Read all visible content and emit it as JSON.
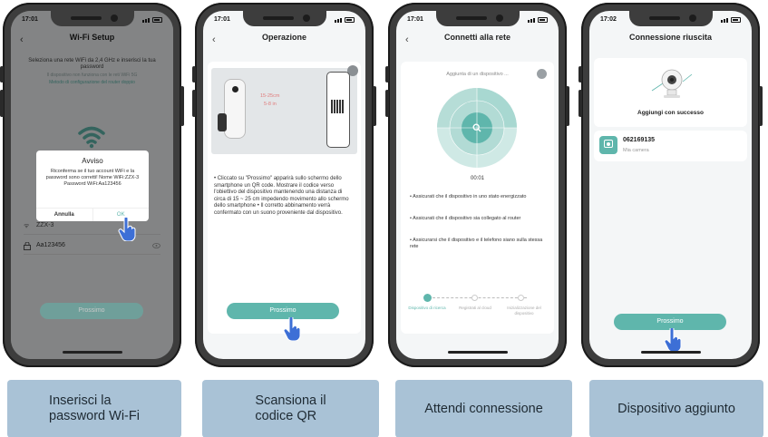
{
  "phones": [
    {
      "status_time": "17:01",
      "nav_title": "Wi-Fi Setup",
      "intro_text": "Seleziona una rete WiFi da 2,4 GHz e inserisci la tua password",
      "note_5g": "Il dispositivo non funziona con le reti WiFi 5G",
      "router_link": "Metodo di configurazione del router doppio",
      "dialog": {
        "title": "Avviso",
        "body": "Riconferma se il tuo account WiFi e la password sono corretti! Nome WiFi:ZZX-3 Password WiFi:Aa123456",
        "cancel": "Annulla",
        "ok": "OK"
      },
      "wifi_name": "ZZX-3",
      "password_value": "Aa123456",
      "next_label": "Prossimo"
    },
    {
      "status_time": "17:01",
      "nav_title": "Operazione",
      "distance_1": "15-25cm",
      "distance_2": "5-8 in",
      "instructions": "• Cliccato su \"Prossimo\" apparirà sullo schermo dello smartphone un QR code. Mostrare il codice verso l'obiettivo del dispositivo mantenendo una distanza di circa di 15 ~ 25 cm impedendo movimento allo schermo dello smartphone • Il corretto abbinamento verrà confermato con un suono proveniente dal dispositivo.",
      "next_label": "Prossimo"
    },
    {
      "status_time": "17:01",
      "nav_title": "Connetti alla rete",
      "adding_label": "Aggiunta di un dispositivo ...",
      "timer": "00:01",
      "tips": [
        "• Assicurati che il dispositivo in uno stato energizzato",
        "• Assicurati che il dispositivo sia collegato al router",
        "• Assicurarsi che il dispositivo e il telefono siano sulla stessa rete"
      ],
      "steps": [
        "Dispositivo di ricerca",
        "Registrati al cloud",
        "Inizializzazione del dispositivo"
      ]
    },
    {
      "status_time": "17:02",
      "nav_title": "Connessione riuscita",
      "success_label": "Aggiungi con successo",
      "device_id": "062169135",
      "device_name": "Mia camera",
      "next_label": "Prossimo"
    }
  ],
  "captions": [
    [
      "Inserisci la",
      "password Wi-Fi"
    ],
    [
      "Scansiona il",
      "codice QR"
    ],
    [
      "Attendi connessione"
    ],
    [
      "Dispositivo aggiunto"
    ]
  ],
  "colors": {
    "accent": "#5fb6ac",
    "caption_bg": "#a9c2d6",
    "phone_frame": "#3d3d3d"
  }
}
